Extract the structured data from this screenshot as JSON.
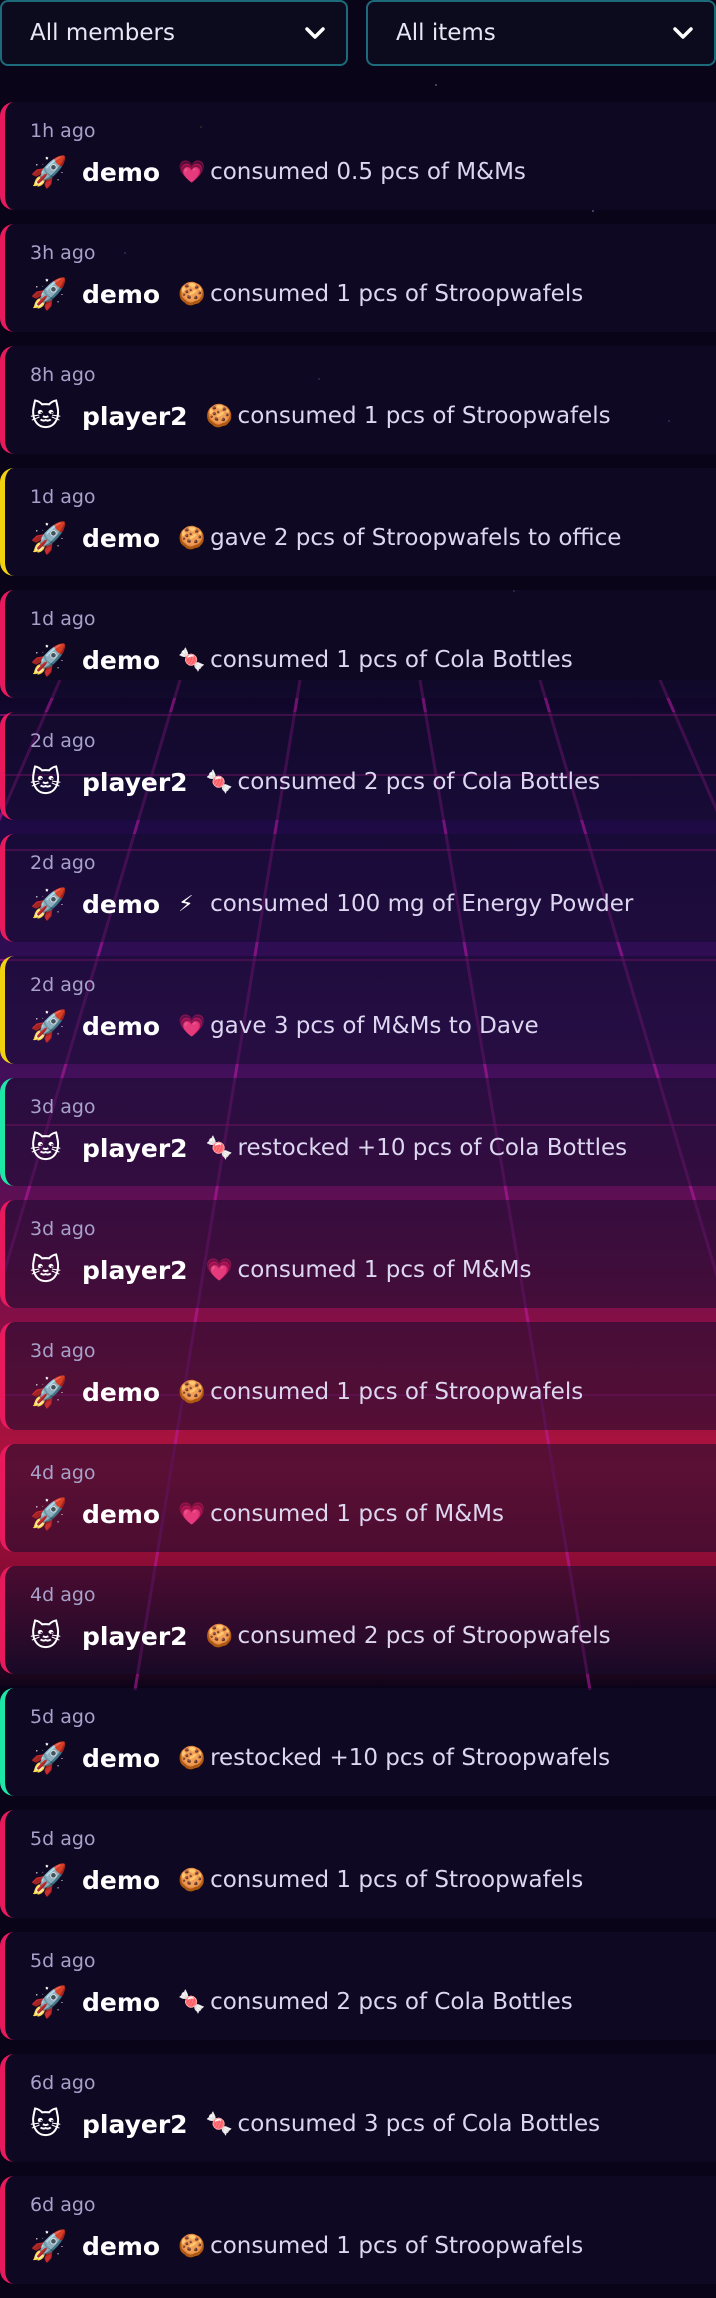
{
  "filters": {
    "members": "All members",
    "items": "All items"
  },
  "entries": [
    {
      "time": "1h ago",
      "avatar": "🚀",
      "member": "demo",
      "icon": "💗",
      "text": "consumed 0.5 pcs of M&Ms",
      "kind": "consume"
    },
    {
      "time": "3h ago",
      "avatar": "🚀",
      "member": "demo",
      "icon": "🍪",
      "text": "consumed 1 pcs of Stroopwafels",
      "kind": "consume"
    },
    {
      "time": "8h ago",
      "avatar": "🐱",
      "member": "player2",
      "icon": "🍪",
      "text": "consumed 1 pcs of Stroopwafels",
      "kind": "consume"
    },
    {
      "time": "1d ago",
      "avatar": "🚀",
      "member": "demo",
      "icon": "🍪",
      "text": "gave 2 pcs of Stroopwafels to office",
      "kind": "give"
    },
    {
      "time": "1d ago",
      "avatar": "🚀",
      "member": "demo",
      "icon": "🍬",
      "text": "consumed 1 pcs of Cola Bottles",
      "kind": "consume"
    },
    {
      "time": "2d ago",
      "avatar": "🐱",
      "member": "player2",
      "icon": "🍬",
      "text": "consumed 2 pcs of Cola Bottles",
      "kind": "consume"
    },
    {
      "time": "2d ago",
      "avatar": "🚀",
      "member": "demo",
      "icon": "⚡",
      "text": "consumed 100 mg of Energy Powder",
      "kind": "consume"
    },
    {
      "time": "2d ago",
      "avatar": "🚀",
      "member": "demo",
      "icon": "💗",
      "text": "gave 3 pcs of M&Ms to Dave",
      "kind": "give"
    },
    {
      "time": "3d ago",
      "avatar": "🐱",
      "member": "player2",
      "icon": "🍬",
      "text": "restocked +10 pcs of Cola Bottles",
      "kind": "restock"
    },
    {
      "time": "3d ago",
      "avatar": "🐱",
      "member": "player2",
      "icon": "💗",
      "text": "consumed 1 pcs of M&Ms",
      "kind": "consume"
    },
    {
      "time": "3d ago",
      "avatar": "🚀",
      "member": "demo",
      "icon": "🍪",
      "text": "consumed 1 pcs of Stroopwafels",
      "kind": "consume"
    },
    {
      "time": "4d ago",
      "avatar": "🚀",
      "member": "demo",
      "icon": "💗",
      "text": "consumed 1 pcs of M&Ms",
      "kind": "consume"
    },
    {
      "time": "4d ago",
      "avatar": "🐱",
      "member": "player2",
      "icon": "🍪",
      "text": "consumed 2 pcs of Stroopwafels",
      "kind": "consume"
    },
    {
      "time": "5d ago",
      "avatar": "🚀",
      "member": "demo",
      "icon": "🍪",
      "text": "restocked +10 pcs of Stroopwafels",
      "kind": "restock"
    },
    {
      "time": "5d ago",
      "avatar": "🚀",
      "member": "demo",
      "icon": "🍪",
      "text": "consumed 1 pcs of Stroopwafels",
      "kind": "consume"
    },
    {
      "time": "5d ago",
      "avatar": "🚀",
      "member": "demo",
      "icon": "🍬",
      "text": "consumed 2 pcs of Cola Bottles",
      "kind": "consume"
    },
    {
      "time": "6d ago",
      "avatar": "🐱",
      "member": "player2",
      "icon": "🍬",
      "text": "consumed 3 pcs of Cola Bottles",
      "kind": "consume"
    },
    {
      "time": "6d ago",
      "avatar": "🚀",
      "member": "demo",
      "icon": "🍪",
      "text": "consumed 1 pcs of Stroopwafels",
      "kind": "consume"
    }
  ],
  "colors": {
    "consume": "#e81a5d",
    "give": "#f2d10f",
    "restock": "#1ee8a8",
    "background": "#0a0418",
    "select_border": "#1d6b7a"
  }
}
